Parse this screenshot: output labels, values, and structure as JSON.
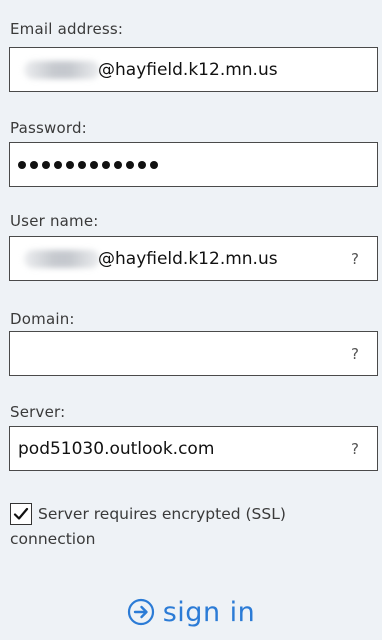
{
  "form": {
    "email": {
      "label": "Email address:",
      "value": "@hayfield.k12.mn.us"
    },
    "password": {
      "label": "Password:",
      "masked_length": 12
    },
    "username": {
      "label": "User name:",
      "value": "@hayfield.k12.mn.us",
      "help": "?"
    },
    "domain": {
      "label": "Domain:",
      "value": "",
      "help": "?"
    },
    "server": {
      "label": "Server:",
      "value": "pod51030.outlook.com",
      "help": "?"
    },
    "ssl": {
      "checked": true,
      "label": "Server requires encrypted (SSL) connection"
    }
  },
  "actions": {
    "sign_in_label": "sign in",
    "sign_in_icon": "arrow-circle-right-icon"
  },
  "colors": {
    "background": "#eef2f6",
    "accent": "#2b7bd6",
    "field_border": "#4a4a4a"
  }
}
